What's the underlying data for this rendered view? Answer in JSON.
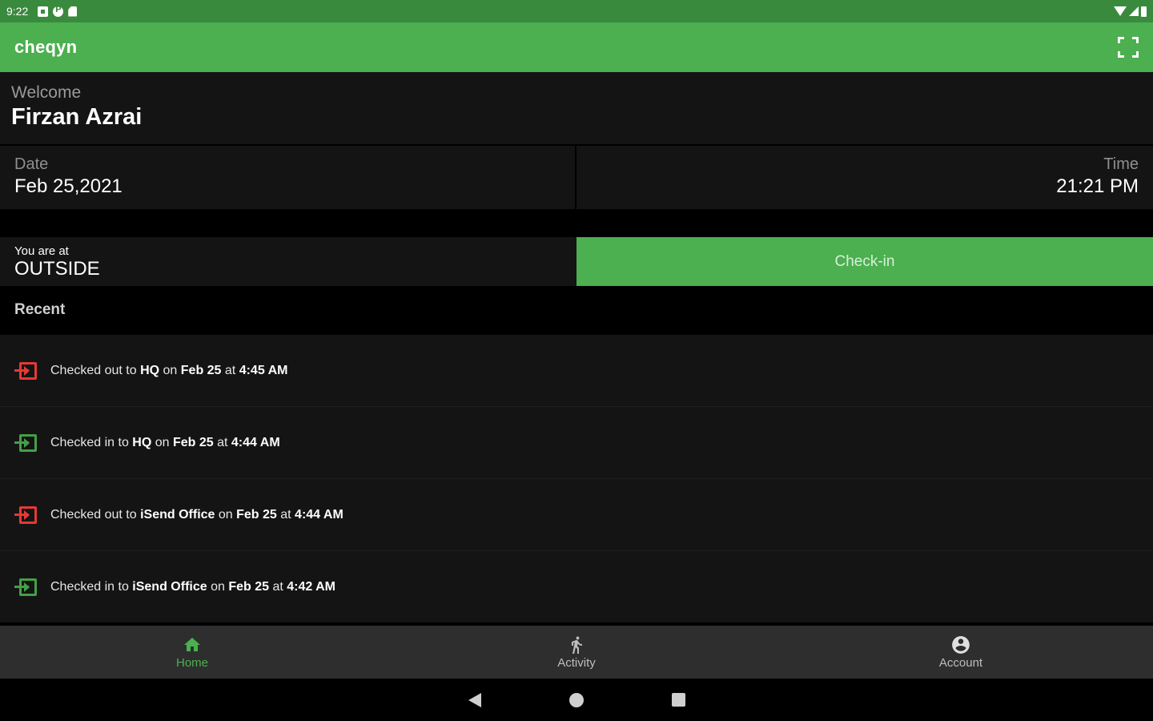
{
  "status_bar": {
    "time": "9:22",
    "icons": [
      "notification-square-icon",
      "pinterest-icon",
      "sd-card-icon",
      "wifi-icon",
      "signal-icon",
      "battery-icon"
    ]
  },
  "app_bar": {
    "title": "cheqyn",
    "fullscreen_icon": "fullscreen-icon"
  },
  "welcome": {
    "label": "Welcome",
    "name": "Firzan Azrai"
  },
  "datetime": {
    "date_label": "Date",
    "date_value": "Feb 25,2021",
    "time_label": "Time",
    "time_value": "21:21 PM"
  },
  "location": {
    "label": "You are at",
    "value": "OUTSIDE",
    "checkin_label": "Check-in"
  },
  "recent": {
    "header": "Recent",
    "items": [
      {
        "type": "out",
        "action": "Checked out to ",
        "place": "HQ",
        "on": " on ",
        "date": "Feb 25",
        "at": " at ",
        "time": "4:45 AM"
      },
      {
        "type": "in",
        "action": "Checked in to ",
        "place": "HQ",
        "on": " on ",
        "date": "Feb 25",
        "at": " at ",
        "time": "4:44 AM"
      },
      {
        "type": "out",
        "action": "Checked out to ",
        "place": "iSend Office",
        "on": " on ",
        "date": "Feb 25",
        "at": " at ",
        "time": "4:44 AM"
      },
      {
        "type": "in",
        "action": "Checked in to ",
        "place": "iSend Office",
        "on": " on ",
        "date": "Feb 25",
        "at": " at ",
        "time": "4:42 AM"
      }
    ]
  },
  "bottom_nav": {
    "items": [
      {
        "label": "Home",
        "icon": "home-icon",
        "active": true
      },
      {
        "label": "Activity",
        "icon": "walking-icon",
        "active": false
      },
      {
        "label": "Account",
        "icon": "account-circle-icon",
        "active": false
      }
    ]
  },
  "colors": {
    "primary": "#4caf50",
    "status_bar": "#3a8a3e",
    "checkout": "#e53935",
    "checkin": "#43a047",
    "surface": "#141414"
  }
}
